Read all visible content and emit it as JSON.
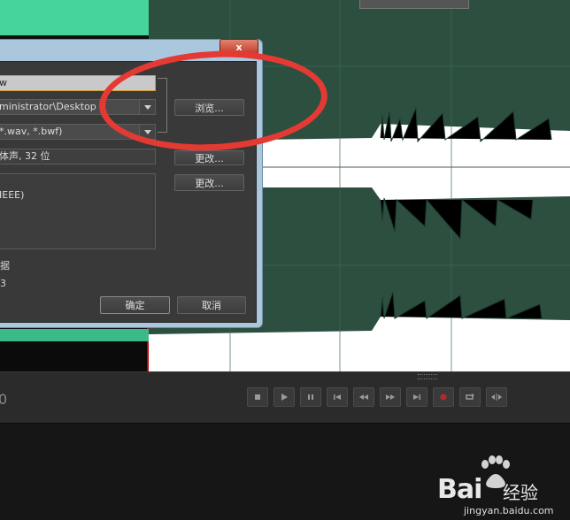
{
  "dialog": {
    "close_label": "x",
    "filename_value": "w",
    "location_value": "ministrator\\Desktop",
    "browse_label": "浏览...",
    "format_value": "*.wav, *.bwf)",
    "sample_type_value": "体声, 32 位",
    "change_label_1": "更改...",
    "change_label_2": "更改...",
    "format_settings_text": "IEEE)",
    "metadata_label": "据",
    "size_text": "3",
    "ok_label": "确定",
    "cancel_label": "取消"
  },
  "transport": {
    "time_display": "0",
    "buttons": [
      "stop-icon",
      "play-icon",
      "pause-icon",
      "goto-start-icon",
      "rewind-icon",
      "fast-forward-icon",
      "goto-end-icon",
      "record-icon",
      "loop-icon",
      "skip-icon"
    ]
  },
  "watermark": {
    "brand": "Bai",
    "brand_suffix": "经验",
    "url": "jingyan.baidu.com"
  },
  "colors": {
    "waveform_bg": "#2c4f40",
    "waveform": "#1c3a2e",
    "selection_bg": "#ffffff",
    "selected_wave_green": "#4fdfa0",
    "highlight_ring": "#e53a33",
    "dialog_frame": "#aac7de",
    "playhead": "#ff0000"
  }
}
